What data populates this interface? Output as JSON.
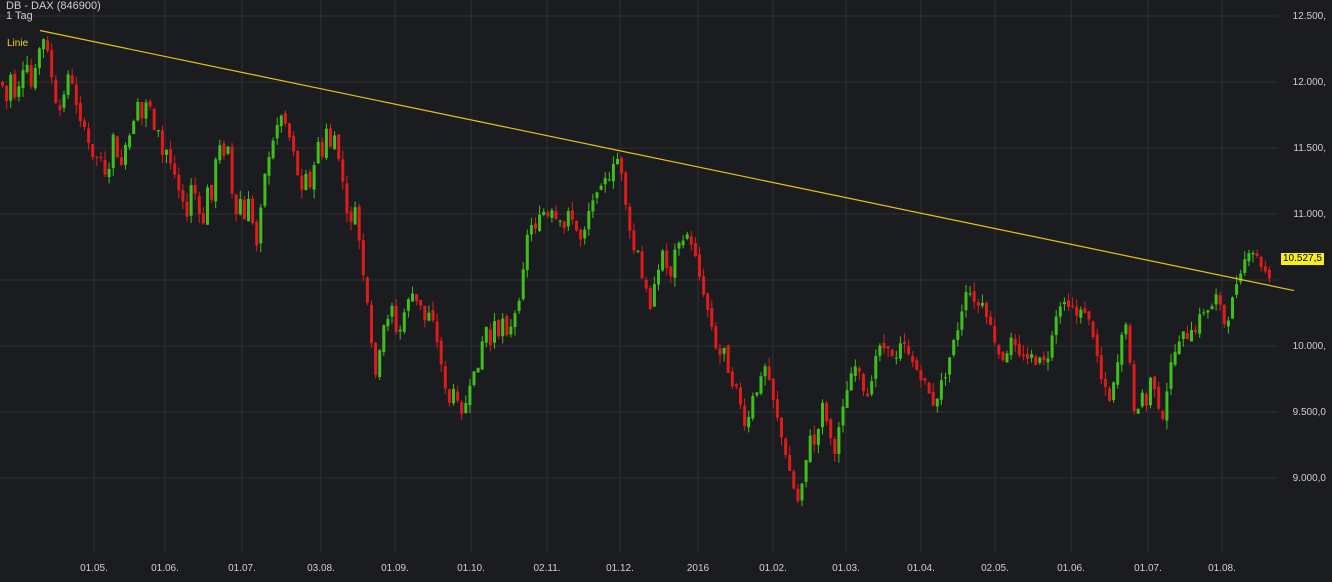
{
  "header": {
    "title": "DB - DAX (846900)",
    "period": "1 Tag"
  },
  "annotation": {
    "line_label": "Linie",
    "last_price_label": "10.527,5"
  },
  "colors": {
    "background": "#1b1c1f",
    "grid": "#2e3034",
    "up": "#3fbf1d",
    "down": "#e01b1b",
    "trendline": "#e6c21a",
    "price_tag": "#f7ef1c"
  },
  "chart_data": {
    "type": "candlestick",
    "title": "DB - DAX (846900)",
    "period": "1 Tag",
    "y_ticks": [
      {
        "value": 12500,
        "label": "12.500,"
      },
      {
        "value": 12000,
        "label": "12.000,"
      },
      {
        "value": 11500,
        "label": "11.500,"
      },
      {
        "value": 11000,
        "label": "11.000,"
      },
      {
        "value": 10000,
        "label": "10.000,"
      },
      {
        "value": 9500,
        "label": "9.500,0"
      },
      {
        "value": 9000,
        "label": "9.000,0"
      }
    ],
    "x_ticks": [
      "01.05.",
      "01.06.",
      "01.07.",
      "03.08.",
      "01.09.",
      "01.10.",
      "02.11.",
      "01.12.",
      "2016",
      "01.02.",
      "01.03.",
      "01.04.",
      "02.05.",
      "01.06.",
      "01.07.",
      "01.08."
    ],
    "ylim": [
      8600,
      12600
    ],
    "grid": true,
    "last_price": 10527.5,
    "trendline": {
      "label": "Linie",
      "start_price": 12390,
      "end_price": 10420
    },
    "path": [
      [
        0,
        12000
      ],
      [
        5,
        11850
      ],
      [
        10,
        12100
      ],
      [
        13,
        11900
      ],
      [
        18,
        12000
      ],
      [
        24,
        12200
      ],
      [
        30,
        11950
      ],
      [
        36,
        12150
      ],
      [
        40,
        12390
      ],
      [
        45,
        12250
      ],
      [
        48,
        12150
      ],
      [
        52,
        11950
      ],
      [
        57,
        11750
      ],
      [
        62,
        11900
      ],
      [
        67,
        12050
      ],
      [
        71,
        12000
      ],
      [
        75,
        11800
      ],
      [
        80,
        11650
      ],
      [
        84,
        11700
      ],
      [
        88,
        11500
      ],
      [
        93,
        11350
      ],
      [
        97,
        11500
      ],
      [
        102,
        11300
      ],
      [
        106,
        11250
      ],
      [
        111,
        11600
      ],
      [
        116,
        11450
      ],
      [
        120,
        11350
      ],
      [
        124,
        11550
      ],
      [
        128,
        11600
      ],
      [
        133,
        11750
      ],
      [
        137,
        11900
      ],
      [
        141,
        11700
      ],
      [
        145,
        11850
      ],
      [
        149,
        11800
      ],
      [
        153,
        11600
      ],
      [
        157,
        11650
      ],
      [
        161,
        11450
      ],
      [
        166,
        11500
      ],
      [
        170,
        11350
      ],
      [
        174,
        11250
      ],
      [
        178,
        11150
      ],
      [
        182,
        11050
      ],
      [
        186,
        11000
      ],
      [
        190,
        11250
      ],
      [
        194,
        11150
      ],
      [
        198,
        11000
      ],
      [
        202,
        10950
      ],
      [
        206,
        11200
      ],
      [
        210,
        11100
      ],
      [
        214,
        11400
      ],
      [
        218,
        11500
      ],
      [
        222,
        11450
      ],
      [
        226,
        11550
      ],
      [
        230,
        11200
      ],
      [
        234,
        11000
      ],
      [
        238,
        11150
      ],
      [
        242,
        10950
      ],
      [
        247,
        11100
      ],
      [
        251,
        10950
      ],
      [
        255,
        10750
      ],
      [
        259,
        11000
      ],
      [
        263,
        11300
      ],
      [
        267,
        11400
      ],
      [
        271,
        11550
      ],
      [
        275,
        11650
      ],
      [
        279,
        11750
      ],
      [
        283,
        11700
      ],
      [
        287,
        11600
      ],
      [
        291,
        11500
      ],
      [
        295,
        11350
      ],
      [
        300,
        11150
      ],
      [
        305,
        11300
      ],
      [
        309,
        11200
      ],
      [
        313,
        11400
      ],
      [
        317,
        11550
      ],
      [
        321,
        11450
      ],
      [
        325,
        11650
      ],
      [
        329,
        11500
      ],
      [
        333,
        11600
      ],
      [
        337,
        11450
      ],
      [
        341,
        11250
      ],
      [
        345,
        11050
      ],
      [
        349,
        10900
      ],
      [
        353,
        11100
      ],
      [
        357,
        10850
      ],
      [
        361,
        10600
      ],
      [
        365,
        10400
      ],
      [
        369,
        10150
      ],
      [
        373,
        9700
      ],
      [
        377,
        9900
      ],
      [
        381,
        10200
      ],
      [
        385,
        10100
      ],
      [
        389,
        10350
      ],
      [
        393,
        10200
      ],
      [
        397,
        10000
      ],
      [
        401,
        10300
      ],
      [
        405,
        10200
      ],
      [
        409,
        10500
      ],
      [
        413,
        10300
      ],
      [
        417,
        10400
      ],
      [
        421,
        10250
      ],
      [
        425,
        10150
      ],
      [
        429,
        10300
      ],
      [
        433,
        10100
      ],
      [
        437,
        10000
      ],
      [
        441,
        9800
      ],
      [
        445,
        9600
      ],
      [
        449,
        9550
      ],
      [
        453,
        9750
      ],
      [
        457,
        9500
      ],
      [
        461,
        9450
      ],
      [
        465,
        9600
      ],
      [
        469,
        9750
      ],
      [
        473,
        9850
      ],
      [
        477,
        9800
      ],
      [
        481,
        10050
      ],
      [
        485,
        10150
      ],
      [
        489,
        10000
      ],
      [
        493,
        10200
      ],
      [
        497,
        10100
      ],
      [
        501,
        10200
      ],
      [
        505,
        10050
      ],
      [
        509,
        10150
      ],
      [
        513,
        10250
      ],
      [
        517,
        10350
      ],
      [
        521,
        10500
      ],
      [
        525,
        10800
      ],
      [
        529,
        10950
      ],
      [
        533,
        10850
      ],
      [
        537,
        10950
      ],
      [
        541,
        11050
      ],
      [
        545,
        10950
      ],
      [
        549,
        11100
      ],
      [
        553,
        10950
      ],
      [
        557,
        11050
      ],
      [
        561,
        10850
      ],
      [
        565,
        10950
      ],
      [
        569,
        11050
      ],
      [
        573,
        10900
      ],
      [
        577,
        10850
      ],
      [
        581,
        10750
      ],
      [
        585,
        10950
      ],
      [
        589,
        11050
      ],
      [
        593,
        11100
      ],
      [
        597,
        11250
      ],
      [
        601,
        11150
      ],
      [
        605,
        11350
      ],
      [
        609,
        11250
      ],
      [
        613,
        11400
      ],
      [
        617,
        11420
      ],
      [
        621,
        11300
      ],
      [
        625,
        11050
      ],
      [
        629,
        10850
      ],
      [
        633,
        10700
      ],
      [
        637,
        10750
      ],
      [
        641,
        10500
      ],
      [
        645,
        10400
      ],
      [
        649,
        10250
      ],
      [
        653,
        10500
      ],
      [
        657,
        10600
      ],
      [
        661,
        10700
      ],
      [
        665,
        10600
      ],
      [
        669,
        10500
      ],
      [
        673,
        10700
      ],
      [
        677,
        10750
      ],
      [
        681,
        10800
      ],
      [
        685,
        10850
      ],
      [
        689,
        10800
      ],
      [
        693,
        10700
      ],
      [
        697,
        10550
      ],
      [
        701,
        10450
      ],
      [
        705,
        10300
      ],
      [
        709,
        10200
      ],
      [
        713,
        10050
      ],
      [
        717,
        9900
      ],
      [
        721,
        10000
      ],
      [
        725,
        9900
      ],
      [
        729,
        9700
      ],
      [
        733,
        9750
      ],
      [
        737,
        9600
      ],
      [
        741,
        9500
      ],
      [
        745,
        9350
      ],
      [
        749,
        9550
      ],
      [
        753,
        9700
      ],
      [
        757,
        9650
      ],
      [
        761,
        9800
      ],
      [
        765,
        9850
      ],
      [
        769,
        9650
      ],
      [
        773,
        9550
      ],
      [
        777,
        9400
      ],
      [
        781,
        9300
      ],
      [
        785,
        9150
      ],
      [
        789,
        9000
      ],
      [
        793,
        8900
      ],
      [
        797,
        8800
      ],
      [
        801,
        8950
      ],
      [
        805,
        9150
      ],
      [
        809,
        9350
      ],
      [
        813,
        9250
      ],
      [
        817,
        9400
      ],
      [
        821,
        9550
      ],
      [
        825,
        9450
      ],
      [
        829,
        9300
      ],
      [
        833,
        9200
      ],
      [
        837,
        9350
      ],
      [
        841,
        9500
      ],
      [
        845,
        9650
      ],
      [
        849,
        9750
      ],
      [
        853,
        9850
      ],
      [
        857,
        9800
      ],
      [
        861,
        9700
      ],
      [
        865,
        9600
      ],
      [
        869,
        9700
      ],
      [
        873,
        9900
      ],
      [
        877,
        10000
      ],
      [
        881,
        9950
      ],
      [
        885,
        10050
      ],
      [
        889,
        9950
      ],
      [
        893,
        9850
      ],
      [
        897,
        9950
      ],
      [
        901,
        10050
      ],
      [
        905,
        9950
      ],
      [
        909,
        9900
      ],
      [
        913,
        9850
      ],
      [
        917,
        9800
      ],
      [
        921,
        9750
      ],
      [
        925,
        9700
      ],
      [
        929,
        9600
      ],
      [
        933,
        9550
      ],
      [
        937,
        9650
      ],
      [
        941,
        9750
      ],
      [
        945,
        9800
      ],
      [
        949,
        9950
      ],
      [
        953,
        10050
      ],
      [
        957,
        10150
      ],
      [
        961,
        10300
      ],
      [
        965,
        10450
      ],
      [
        969,
        10400
      ],
      [
        973,
        10350
      ],
      [
        977,
        10300
      ],
      [
        981,
        10350
      ],
      [
        985,
        10250
      ],
      [
        989,
        10150
      ],
      [
        993,
        10050
      ],
      [
        997,
        9950
      ],
      [
        1001,
        9900
      ],
      [
        1005,
        9950
      ],
      [
        1009,
        10050
      ],
      [
        1013,
        10000
      ],
      [
        1017,
        9900
      ],
      [
        1021,
        9950
      ],
      [
        1025,
        9900
      ],
      [
        1029,
        9950
      ],
      [
        1033,
        9850
      ],
      [
        1037,
        9950
      ],
      [
        1041,
        9900
      ],
      [
        1045,
        9850
      ],
      [
        1049,
        10050
      ],
      [
        1053,
        10200
      ],
      [
        1057,
        10300
      ],
      [
        1061,
        10350
      ],
      [
        1065,
        10300
      ],
      [
        1069,
        10350
      ],
      [
        1073,
        10250
      ],
      [
        1077,
        10200
      ],
      [
        1081,
        10300
      ],
      [
        1085,
        10250
      ],
      [
        1089,
        10150
      ],
      [
        1093,
        10050
      ],
      [
        1097,
        9850
      ],
      [
        1101,
        9700
      ],
      [
        1105,
        9650
      ],
      [
        1109,
        9550
      ],
      [
        1113,
        9750
      ],
      [
        1117,
        9900
      ],
      [
        1121,
        10100
      ],
      [
        1125,
        10200
      ],
      [
        1129,
        9800
      ],
      [
        1133,
        9450
      ],
      [
        1137,
        9550
      ],
      [
        1141,
        9650
      ],
      [
        1145,
        9550
      ],
      [
        1149,
        9750
      ],
      [
        1153,
        9700
      ],
      [
        1157,
        9550
      ],
      [
        1161,
        9450
      ],
      [
        1165,
        9650
      ],
      [
        1169,
        9850
      ],
      [
        1173,
        9950
      ],
      [
        1177,
        10000
      ],
      [
        1181,
        10100
      ],
      [
        1185,
        10050
      ],
      [
        1189,
        10150
      ],
      [
        1193,
        10100
      ],
      [
        1197,
        10200
      ],
      [
        1201,
        10250
      ],
      [
        1205,
        10300
      ],
      [
        1209,
        10250
      ],
      [
        1213,
        10400
      ],
      [
        1217,
        10350
      ],
      [
        1221,
        10200
      ],
      [
        1225,
        10150
      ],
      [
        1229,
        10300
      ],
      [
        1233,
        10400
      ],
      [
        1237,
        10550
      ],
      [
        1241,
        10600
      ],
      [
        1245,
        10700
      ],
      [
        1249,
        10750
      ],
      [
        1253,
        10700
      ],
      [
        1257,
        10650
      ],
      [
        1261,
        10600
      ],
      [
        1265,
        10550
      ],
      [
        1269,
        10527.5
      ]
    ]
  }
}
